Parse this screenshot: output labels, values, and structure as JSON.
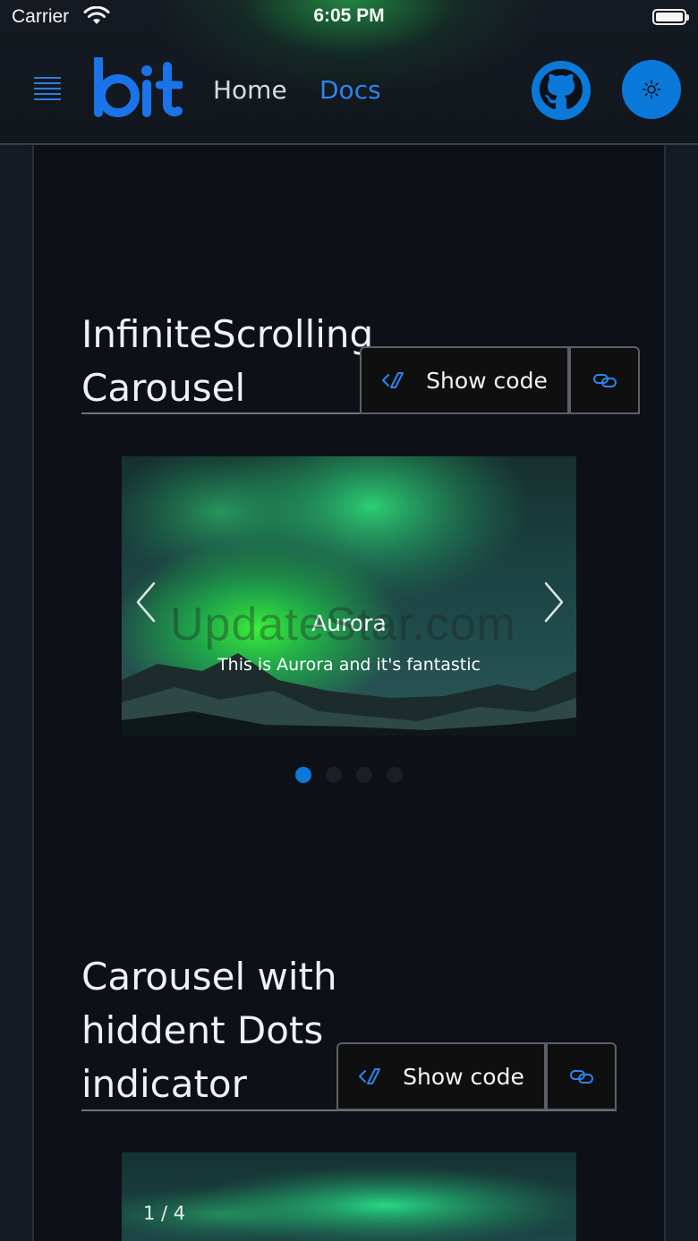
{
  "status_bar": {
    "carrier": "Carrier",
    "time": "6:05 PM"
  },
  "header": {
    "logo_icon": "bit-logo",
    "nav": [
      {
        "label": "Home",
        "active": false
      },
      {
        "label": "Docs",
        "active": true
      }
    ],
    "github_icon": "github-icon",
    "theme_icon": "sun-icon",
    "accent_color": "#0b79d9"
  },
  "sections": [
    {
      "title": "InfiniteScrolling Carousel",
      "show_code_label": "Show code",
      "link_icon": "link-icon",
      "carousel": {
        "slide_title": "Aurora",
        "slide_description": "This is Aurora and it's fantastic",
        "dots_count": 4,
        "active_dot": 1
      }
    },
    {
      "title": "Carousel with hiddent Dots indicator",
      "show_code_label": "Show code",
      "link_icon": "link-icon",
      "carousel": {
        "counter": "1 / 4"
      }
    }
  ],
  "watermark": "UpdateStar.com"
}
